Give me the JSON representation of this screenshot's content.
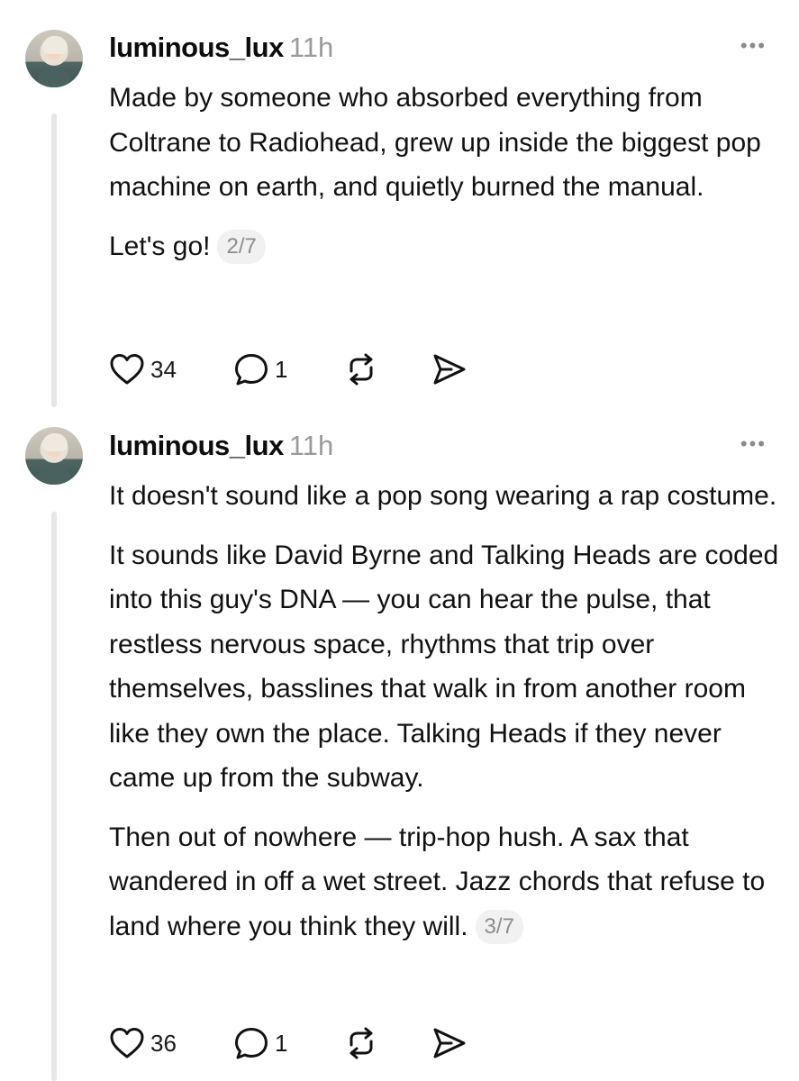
{
  "posts": [
    {
      "username": "luminous_lux",
      "time": "11h",
      "paragraphs": [
        "Made by someone who absorbed everything from Coltrane to Radiohead, grew up inside the biggest pop machine on earth, and quietly burned the manual.",
        "Let's go!"
      ],
      "counter": "2/7",
      "likes": "34",
      "replies": "1"
    },
    {
      "username": "luminous_lux",
      "time": "11h",
      "paragraphs": [
        "It doesn't sound like a pop song wearing a rap costume.",
        "It sounds like David Byrne and Talking Heads are coded into this guy's DNA — you can hear the pulse, that restless nervous space, rhythms that trip over themselves, basslines that walk in from another room like they own the place. Talking Heads if they never came up from the subway.",
        "Then out of nowhere — trip-hop hush. A sax that wandered in off a wet street. Jazz chords that refuse to land where you think they will."
      ],
      "counter": "3/7",
      "likes": "36",
      "replies": "1"
    }
  ],
  "icons": {
    "like": "heart-icon",
    "reply": "comment-icon",
    "repost": "repost-icon",
    "share": "send-icon",
    "more": "more-icon"
  },
  "more_label": "•••"
}
